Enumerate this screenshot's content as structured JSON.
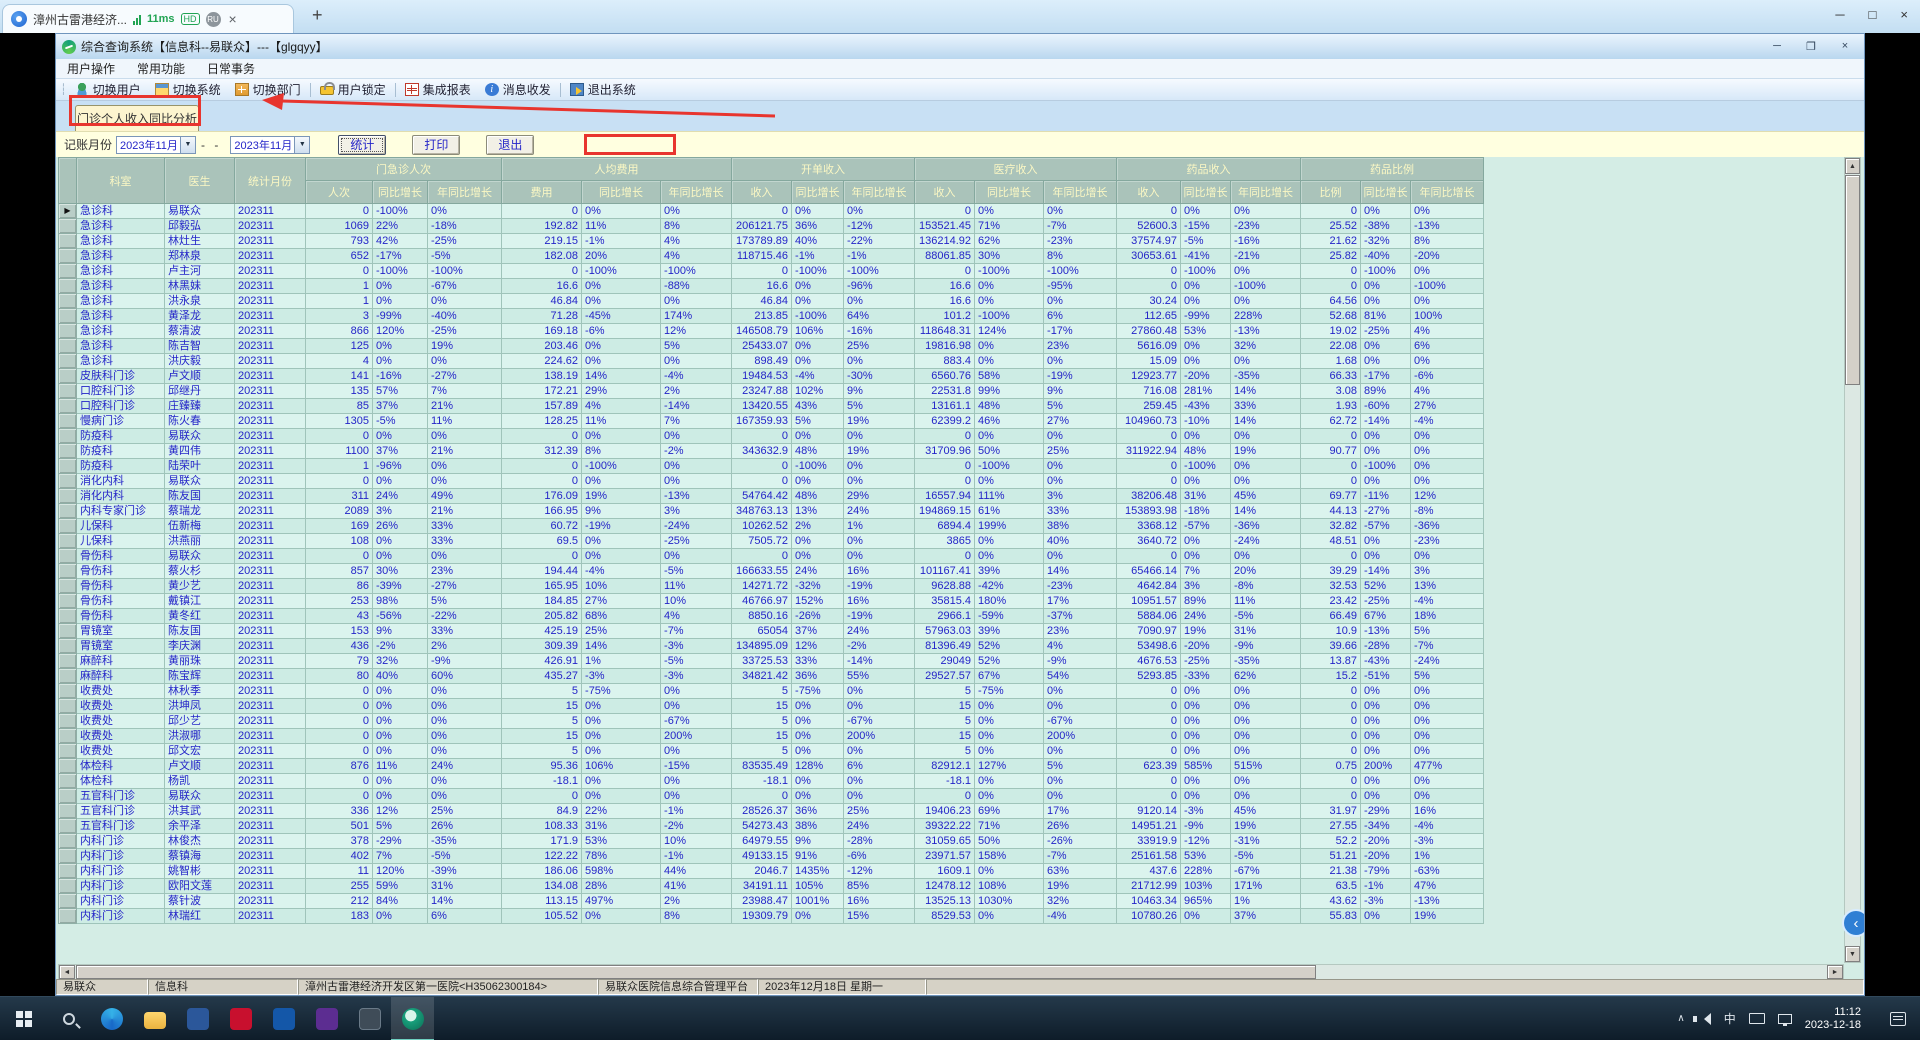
{
  "browser": {
    "tab_title": "漳州古雷港经济...",
    "latency_badge": "11ms",
    "hd_badge": "HD",
    "ru_badge": "RU",
    "tab_close": "×",
    "new_tab": "+",
    "window_controls": [
      "─",
      "□",
      "×"
    ]
  },
  "window": {
    "title": "综合查询系统【信息科--易联众】---【glgqyy】",
    "controls": [
      "─",
      "❐",
      "×"
    ]
  },
  "menu": {
    "items": [
      "用户操作",
      "常用功能",
      "日常事务"
    ]
  },
  "toolbar": {
    "items": [
      "切换用户",
      "切换系统",
      "切换部门",
      "用户锁定",
      "集成报表",
      "消息收发",
      "退出系统"
    ]
  },
  "tab": {
    "label": "门诊个人收入同比分析"
  },
  "params": {
    "label": "记账月份",
    "from": "2023年11月",
    "to": "2023年11月",
    "separator": "- -",
    "buttons": [
      "统计",
      "打印",
      "退出"
    ]
  },
  "table": {
    "plain_headers": [
      "科室",
      "医生",
      "统计月份"
    ],
    "groups": [
      {
        "label": "门急诊人次",
        "cols": [
          "人次",
          "同比增长",
          "年同比增长"
        ]
      },
      {
        "label": "人均费用",
        "cols": [
          "费用",
          "同比增长",
          "年同比增长"
        ]
      },
      {
        "label": "开单收入",
        "cols": [
          "收入",
          "同比增长",
          "年同比增长"
        ]
      },
      {
        "label": "医疗收入",
        "cols": [
          "收入",
          "同比增长",
          "年同比增长"
        ]
      },
      {
        "label": "药品收入",
        "cols": [
          "收入",
          "同比增长",
          "年同比增长"
        ]
      },
      {
        "label": "药品比例",
        "cols": [
          "比例",
          "同比增长",
          "年同比增长"
        ]
      }
    ],
    "rows": [
      [
        "急诊科",
        "易联众",
        "202311",
        "0",
        "-100%",
        "0%",
        "0",
        "0%",
        "0%",
        "0",
        "0%",
        "0%",
        "0",
        "0%",
        "0%",
        "0",
        "0%",
        "0%",
        "0",
        "0%",
        "0%"
      ],
      [
        "急诊科",
        "邱毅弘",
        "202311",
        "1069",
        "22%",
        "-18%",
        "192.82",
        "11%",
        "8%",
        "206121.75",
        "36%",
        "-12%",
        "153521.45",
        "71%",
        "-7%",
        "52600.3",
        "-15%",
        "-23%",
        "25.52",
        "-38%",
        "-13%"
      ],
      [
        "急诊科",
        "林灶生",
        "202311",
        "793",
        "42%",
        "-25%",
        "219.15",
        "-1%",
        "4%",
        "173789.89",
        "40%",
        "-22%",
        "136214.92",
        "62%",
        "-23%",
        "37574.97",
        "-5%",
        "-16%",
        "21.62",
        "-32%",
        "8%"
      ],
      [
        "急诊科",
        "郑林泉",
        "202311",
        "652",
        "-17%",
        "-5%",
        "182.08",
        "20%",
        "4%",
        "118715.46",
        "-1%",
        "-1%",
        "88061.85",
        "30%",
        "8%",
        "30653.61",
        "-41%",
        "-21%",
        "25.82",
        "-40%",
        "-20%"
      ],
      [
        "急诊科",
        "卢主河",
        "202311",
        "0",
        "-100%",
        "-100%",
        "0",
        "-100%",
        "-100%",
        "0",
        "-100%",
        "-100%",
        "0",
        "-100%",
        "-100%",
        "0",
        "-100%",
        "0%",
        "0",
        "-100%",
        "0%"
      ],
      [
        "急诊科",
        "林黑妹",
        "202311",
        "1",
        "0%",
        "-67%",
        "16.6",
        "0%",
        "-88%",
        "16.6",
        "0%",
        "-96%",
        "16.6",
        "0%",
        "-95%",
        "0",
        "0%",
        "-100%",
        "0",
        "0%",
        "-100%"
      ],
      [
        "急诊科",
        "洪永泉",
        "202311",
        "1",
        "0%",
        "0%",
        "46.84",
        "0%",
        "0%",
        "46.84",
        "0%",
        "0%",
        "16.6",
        "0%",
        "0%",
        "30.24",
        "0%",
        "0%",
        "64.56",
        "0%",
        "0%"
      ],
      [
        "急诊科",
        "黄泽龙",
        "202311",
        "3",
        "-99%",
        "-40%",
        "71.28",
        "-45%",
        "174%",
        "213.85",
        "-100%",
        "64%",
        "101.2",
        "-100%",
        "6%",
        "112.65",
        "-99%",
        "228%",
        "52.68",
        "81%",
        "100%"
      ],
      [
        "急诊科",
        "蔡清波",
        "202311",
        "866",
        "120%",
        "-25%",
        "169.18",
        "-6%",
        "12%",
        "146508.79",
        "106%",
        "-16%",
        "118648.31",
        "124%",
        "-17%",
        "27860.48",
        "53%",
        "-13%",
        "19.02",
        "-25%",
        "4%"
      ],
      [
        "急诊科",
        "陈吉智",
        "202311",
        "125",
        "0%",
        "19%",
        "203.46",
        "0%",
        "5%",
        "25433.07",
        "0%",
        "25%",
        "19816.98",
        "0%",
        "23%",
        "5616.09",
        "0%",
        "32%",
        "22.08",
        "0%",
        "6%"
      ],
      [
        "急诊科",
        "洪庆毅",
        "202311",
        "4",
        "0%",
        "0%",
        "224.62",
        "0%",
        "0%",
        "898.49",
        "0%",
        "0%",
        "883.4",
        "0%",
        "0%",
        "15.09",
        "0%",
        "0%",
        "1.68",
        "0%",
        "0%"
      ],
      [
        "皮肤科门诊",
        "卢文顺",
        "202311",
        "141",
        "-16%",
        "-27%",
        "138.19",
        "14%",
        "-4%",
        "19484.53",
        "-4%",
        "-30%",
        "6560.76",
        "58%",
        "-19%",
        "12923.77",
        "-20%",
        "-35%",
        "66.33",
        "-17%",
        "-6%"
      ],
      [
        "口腔科门诊",
        "邱继丹",
        "202311",
        "135",
        "57%",
        "7%",
        "172.21",
        "29%",
        "2%",
        "23247.88",
        "102%",
        "9%",
        "22531.8",
        "99%",
        "9%",
        "716.08",
        "281%",
        "14%",
        "3.08",
        "89%",
        "4%"
      ],
      [
        "口腔科门诊",
        "庄臻臻",
        "202311",
        "85",
        "37%",
        "21%",
        "157.89",
        "4%",
        "-14%",
        "13420.55",
        "43%",
        "5%",
        "13161.1",
        "48%",
        "5%",
        "259.45",
        "-43%",
        "33%",
        "1.93",
        "-60%",
        "27%"
      ],
      [
        "慢病门诊",
        "陈火春",
        "202311",
        "1305",
        "-5%",
        "11%",
        "128.25",
        "11%",
        "7%",
        "167359.93",
        "5%",
        "19%",
        "62399.2",
        "46%",
        "27%",
        "104960.73",
        "-10%",
        "14%",
        "62.72",
        "-14%",
        "-4%"
      ],
      [
        "防疫科",
        "易联众",
        "202311",
        "0",
        "0%",
        "0%",
        "0",
        "0%",
        "0%",
        "0",
        "0%",
        "0%",
        "0",
        "0%",
        "0%",
        "0",
        "0%",
        "0%",
        "0",
        "0%",
        "0%"
      ],
      [
        "防疫科",
        "黄四伟",
        "202311",
        "1100",
        "37%",
        "21%",
        "312.39",
        "8%",
        "-2%",
        "343632.9",
        "48%",
        "19%",
        "31709.96",
        "50%",
        "25%",
        "311922.94",
        "48%",
        "19%",
        "90.77",
        "0%",
        "0%"
      ],
      [
        "防疫科",
        "陆荣叶",
        "202311",
        "1",
        "-96%",
        "0%",
        "0",
        "-100%",
        "0%",
        "0",
        "-100%",
        "0%",
        "0",
        "-100%",
        "0%",
        "0",
        "-100%",
        "0%",
        "0",
        "-100%",
        "0%"
      ],
      [
        "消化内科",
        "易联众",
        "202311",
        "0",
        "0%",
        "0%",
        "0",
        "0%",
        "0%",
        "0",
        "0%",
        "0%",
        "0",
        "0%",
        "0%",
        "0",
        "0%",
        "0%",
        "0",
        "0%",
        "0%"
      ],
      [
        "消化内科",
        "陈友国",
        "202311",
        "311",
        "24%",
        "49%",
        "176.09",
        "19%",
        "-13%",
        "54764.42",
        "48%",
        "29%",
        "16557.94",
        "111%",
        "3%",
        "38206.48",
        "31%",
        "45%",
        "69.77",
        "-11%",
        "12%"
      ],
      [
        "内科专家门诊",
        "蔡瑞龙",
        "202311",
        "2089",
        "3%",
        "21%",
        "166.95",
        "9%",
        "3%",
        "348763.13",
        "13%",
        "24%",
        "194869.15",
        "61%",
        "33%",
        "153893.98",
        "-18%",
        "14%",
        "44.13",
        "-27%",
        "-8%"
      ],
      [
        "儿保科",
        "伍新梅",
        "202311",
        "169",
        "26%",
        "33%",
        "60.72",
        "-19%",
        "-24%",
        "10262.52",
        "2%",
        "1%",
        "6894.4",
        "199%",
        "38%",
        "3368.12",
        "-57%",
        "-36%",
        "32.82",
        "-57%",
        "-36%"
      ],
      [
        "儿保科",
        "洪燕丽",
        "202311",
        "108",
        "0%",
        "33%",
        "69.5",
        "0%",
        "-25%",
        "7505.72",
        "0%",
        "0%",
        "3865",
        "0%",
        "40%",
        "3640.72",
        "0%",
        "-24%",
        "48.51",
        "0%",
        "-23%"
      ],
      [
        "骨伤科",
        "易联众",
        "202311",
        "0",
        "0%",
        "0%",
        "0",
        "0%",
        "0%",
        "0",
        "0%",
        "0%",
        "0",
        "0%",
        "0%",
        "0",
        "0%",
        "0%",
        "0",
        "0%",
        "0%"
      ],
      [
        "骨伤科",
        "蔡火杉",
        "202311",
        "857",
        "30%",
        "23%",
        "194.44",
        "-4%",
        "-5%",
        "166633.55",
        "24%",
        "16%",
        "101167.41",
        "39%",
        "14%",
        "65466.14",
        "7%",
        "20%",
        "39.29",
        "-14%",
        "3%"
      ],
      [
        "骨伤科",
        "黄少艺",
        "202311",
        "86",
        "-39%",
        "-27%",
        "165.95",
        "10%",
        "11%",
        "14271.72",
        "-32%",
        "-19%",
        "9628.88",
        "-42%",
        "-23%",
        "4642.84",
        "3%",
        "-8%",
        "32.53",
        "52%",
        "13%"
      ],
      [
        "骨伤科",
        "戴镇江",
        "202311",
        "253",
        "98%",
        "5%",
        "184.85",
        "27%",
        "10%",
        "46766.97",
        "152%",
        "16%",
        "35815.4",
        "180%",
        "17%",
        "10951.57",
        "89%",
        "11%",
        "23.42",
        "-25%",
        "-4%"
      ],
      [
        "骨伤科",
        "黄冬红",
        "202311",
        "43",
        "-56%",
        "-22%",
        "205.82",
        "68%",
        "4%",
        "8850.16",
        "-26%",
        "-19%",
        "2966.1",
        "-59%",
        "-37%",
        "5884.06",
        "24%",
        "-5%",
        "66.49",
        "67%",
        "18%"
      ],
      [
        "胃镜室",
        "陈友国",
        "202311",
        "153",
        "9%",
        "33%",
        "425.19",
        "25%",
        "-7%",
        "65054",
        "37%",
        "24%",
        "57963.03",
        "39%",
        "23%",
        "7090.97",
        "19%",
        "31%",
        "10.9",
        "-13%",
        "5%"
      ],
      [
        "胃镜室",
        "李庆渊",
        "202311",
        "436",
        "-2%",
        "2%",
        "309.39",
        "14%",
        "-3%",
        "134895.09",
        "12%",
        "-2%",
        "81396.49",
        "52%",
        "4%",
        "53498.6",
        "-20%",
        "-9%",
        "39.66",
        "-28%",
        "-7%"
      ],
      [
        "麻醉科",
        "黄丽珠",
        "202311",
        "79",
        "32%",
        "-9%",
        "426.91",
        "1%",
        "-5%",
        "33725.53",
        "33%",
        "-14%",
        "29049",
        "52%",
        "-9%",
        "4676.53",
        "-25%",
        "-35%",
        "13.87",
        "-43%",
        "-24%"
      ],
      [
        "麻醉科",
        "陈宝辉",
        "202311",
        "80",
        "40%",
        "60%",
        "435.27",
        "-3%",
        "-3%",
        "34821.42",
        "36%",
        "55%",
        "29527.57",
        "67%",
        "54%",
        "5293.85",
        "-33%",
        "62%",
        "15.2",
        "-51%",
        "5%"
      ],
      [
        "收费处",
        "林秋季",
        "202311",
        "0",
        "0%",
        "0%",
        "5",
        "-75%",
        "0%",
        "5",
        "-75%",
        "0%",
        "5",
        "-75%",
        "0%",
        "0",
        "0%",
        "0%",
        "0",
        "0%",
        "0%"
      ],
      [
        "收费处",
        "洪坤凤",
        "202311",
        "0",
        "0%",
        "0%",
        "15",
        "0%",
        "0%",
        "15",
        "0%",
        "0%",
        "15",
        "0%",
        "0%",
        "0",
        "0%",
        "0%",
        "0",
        "0%",
        "0%"
      ],
      [
        "收费处",
        "邱少艺",
        "202311",
        "0",
        "0%",
        "0%",
        "5",
        "0%",
        "-67%",
        "5",
        "0%",
        "-67%",
        "5",
        "0%",
        "-67%",
        "0",
        "0%",
        "0%",
        "0",
        "0%",
        "0%"
      ],
      [
        "收费处",
        "洪淑哪",
        "202311",
        "0",
        "0%",
        "0%",
        "15",
        "0%",
        "200%",
        "15",
        "0%",
        "200%",
        "15",
        "0%",
        "200%",
        "0",
        "0%",
        "0%",
        "0",
        "0%",
        "0%"
      ],
      [
        "收费处",
        "邱文宏",
        "202311",
        "0",
        "0%",
        "0%",
        "5",
        "0%",
        "0%",
        "5",
        "0%",
        "0%",
        "5",
        "0%",
        "0%",
        "0",
        "0%",
        "0%",
        "0",
        "0%",
        "0%"
      ],
      [
        "体检科",
        "卢文顺",
        "202311",
        "876",
        "11%",
        "24%",
        "95.36",
        "106%",
        "-15%",
        "83535.49",
        "128%",
        "6%",
        "82912.1",
        "127%",
        "5%",
        "623.39",
        "585%",
        "515%",
        "0.75",
        "200%",
        "477%"
      ],
      [
        "体检科",
        "杨凯",
        "202311",
        "0",
        "0%",
        "0%",
        "-18.1",
        "0%",
        "0%",
        "-18.1",
        "0%",
        "0%",
        "-18.1",
        "0%",
        "0%",
        "0",
        "0%",
        "0%",
        "0",
        "0%",
        "0%"
      ],
      [
        "五官科门诊",
        "易联众",
        "202311",
        "0",
        "0%",
        "0%",
        "0",
        "0%",
        "0%",
        "0",
        "0%",
        "0%",
        "0",
        "0%",
        "0%",
        "0",
        "0%",
        "0%",
        "0",
        "0%",
        "0%"
      ],
      [
        "五官科门诊",
        "洪其武",
        "202311",
        "336",
        "12%",
        "25%",
        "84.9",
        "22%",
        "-1%",
        "28526.37",
        "36%",
        "25%",
        "19406.23",
        "69%",
        "17%",
        "9120.14",
        "-3%",
        "45%",
        "31.97",
        "-29%",
        "16%"
      ],
      [
        "五官科门诊",
        "余平泽",
        "202311",
        "501",
        "5%",
        "26%",
        "108.33",
        "31%",
        "-2%",
        "54273.43",
        "38%",
        "24%",
        "39322.22",
        "71%",
        "26%",
        "14951.21",
        "-9%",
        "19%",
        "27.55",
        "-34%",
        "-4%"
      ],
      [
        "内科门诊",
        "林俊杰",
        "202311",
        "378",
        "-29%",
        "-35%",
        "171.9",
        "53%",
        "10%",
        "64979.55",
        "9%",
        "-28%",
        "31059.65",
        "50%",
        "-26%",
        "33919.9",
        "-12%",
        "-31%",
        "52.2",
        "-20%",
        "-3%"
      ],
      [
        "内科门诊",
        "蔡镇海",
        "202311",
        "402",
        "7%",
        "-5%",
        "122.22",
        "78%",
        "-1%",
        "49133.15",
        "91%",
        "-6%",
        "23971.57",
        "158%",
        "-7%",
        "25161.58",
        "53%",
        "-5%",
        "51.21",
        "-20%",
        "1%"
      ],
      [
        "内科门诊",
        "姚智彬",
        "202311",
        "11",
        "120%",
        "-39%",
        "186.06",
        "598%",
        "44%",
        "2046.7",
        "1435%",
        "-12%",
        "1609.1",
        "0%",
        "63%",
        "437.6",
        "228%",
        "-67%",
        "21.38",
        "-79%",
        "-63%"
      ],
      [
        "内科门诊",
        "欧阳文莲",
        "202311",
        "255",
        "59%",
        "31%",
        "134.08",
        "28%",
        "41%",
        "34191.11",
        "105%",
        "85%",
        "12478.12",
        "108%",
        "19%",
        "21712.99",
        "103%",
        "171%",
        "63.5",
        "-1%",
        "47%"
      ],
      [
        "内科门诊",
        "蔡针波",
        "202311",
        "212",
        "84%",
        "14%",
        "113.15",
        "497%",
        "2%",
        "23988.47",
        "1001%",
        "16%",
        "13525.13",
        "1030%",
        "32%",
        "10463.34",
        "965%",
        "1%",
        "43.62",
        "-3%",
        "-13%"
      ],
      [
        "内科门诊",
        "林瑞红",
        "202311",
        "183",
        "0%",
        "6%",
        "105.52",
        "0%",
        "8%",
        "19309.79",
        "0%",
        "15%",
        "8529.53",
        "0%",
        "-4%",
        "10780.26",
        "0%",
        "37%",
        "55.83",
        "0%",
        "19%"
      ]
    ]
  },
  "statusbar": {
    "segments": [
      "易联众",
      "信息科",
      "漳州古雷港经济开发区第一医院<H35062300184>",
      "易联众医院信息综合管理平台",
      "2023年12月18日 星期一"
    ]
  },
  "taskbar": {
    "ime": "中",
    "time": "11:12",
    "date": "2023-12-18"
  },
  "colors": {
    "annotation_red": "#e8352e",
    "value_blue": "#2424c8",
    "header_teal": "#aac3ba"
  }
}
